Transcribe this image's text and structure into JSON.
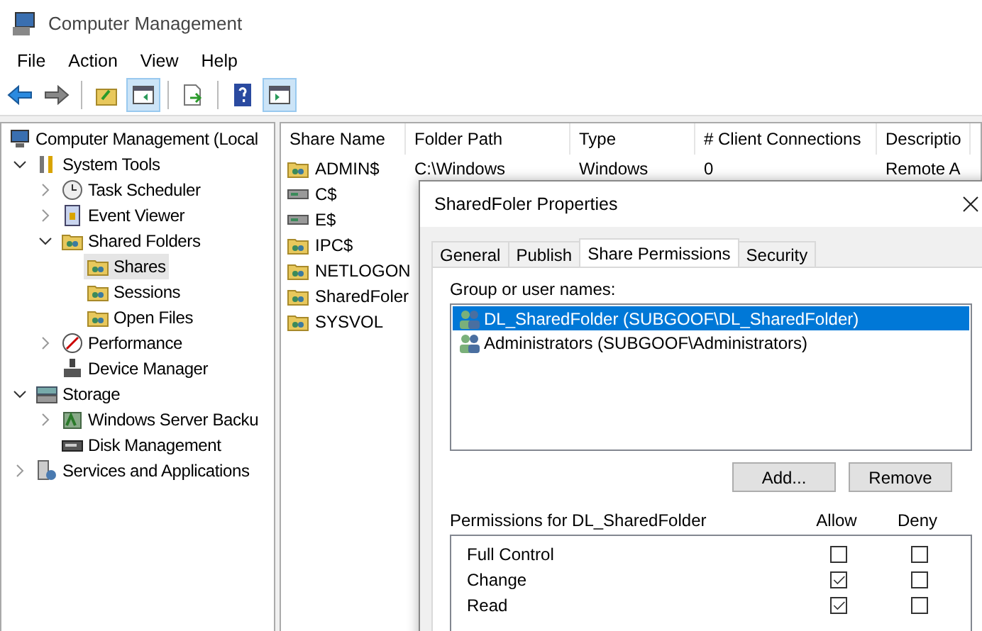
{
  "window": {
    "title": "Computer Management"
  },
  "menu": [
    "File",
    "Action",
    "View",
    "Help"
  ],
  "toolbar": [
    {
      "kind": "back",
      "pressed": false
    },
    {
      "kind": "forward",
      "pressed": false
    },
    {
      "kind": "separator"
    },
    {
      "kind": "up",
      "pressed": false
    },
    {
      "kind": "tree-pane",
      "pressed": true
    },
    {
      "kind": "separator"
    },
    {
      "kind": "export",
      "pressed": false
    },
    {
      "kind": "separator"
    },
    {
      "kind": "help",
      "pressed": false
    },
    {
      "kind": "action-pane",
      "pressed": true
    }
  ],
  "tree": [
    {
      "label": "Computer Management (Local",
      "kind": "computer",
      "selected": false,
      "children": [
        {
          "label": "System Tools",
          "kind": "tools",
          "expanded": true,
          "selected": false,
          "children": [
            {
              "label": "Task Scheduler",
              "kind": "clock",
              "expanded": false,
              "selected": false
            },
            {
              "label": "Event Viewer",
              "kind": "log",
              "expanded": false,
              "selected": false
            },
            {
              "label": "Shared Folders",
              "kind": "share",
              "expanded": true,
              "selected": false,
              "children": [
                {
                  "label": "Shares",
                  "kind": "share",
                  "selected": true
                },
                {
                  "label": "Sessions",
                  "kind": "share",
                  "selected": false
                },
                {
                  "label": "Open Files",
                  "kind": "share",
                  "selected": false
                }
              ]
            },
            {
              "label": "Performance",
              "kind": "gauge",
              "expanded": false,
              "selected": false
            },
            {
              "label": "Device Manager",
              "kind": "device",
              "selected": false
            }
          ]
        },
        {
          "label": "Storage",
          "kind": "storage",
          "expanded": true,
          "selected": false,
          "children": [
            {
              "label": "Windows Server Backu",
              "kind": "backup",
              "expanded": false,
              "selected": false
            },
            {
              "label": "Disk Management",
              "kind": "disk",
              "selected": false
            }
          ]
        },
        {
          "label": "Services and Applications",
          "kind": "services",
          "expanded": false,
          "selected": false
        }
      ]
    }
  ],
  "table": {
    "columns": [
      "Share Name",
      "Folder Path",
      "Type",
      "# Client Connections",
      "Descriptio"
    ],
    "rows": [
      {
        "kind": "share",
        "cells": [
          "ADMIN$",
          "C:\\Windows",
          "Windows",
          "0",
          "Remote A"
        ]
      },
      {
        "kind": "drive",
        "cells": [
          "C$"
        ]
      },
      {
        "kind": "drive",
        "cells": [
          "E$"
        ]
      },
      {
        "kind": "share",
        "cells": [
          "IPC$"
        ]
      },
      {
        "kind": "share",
        "cells": [
          "NETLOGON"
        ]
      },
      {
        "kind": "share",
        "cells": [
          "SharedFoler"
        ]
      },
      {
        "kind": "share",
        "cells": [
          "SYSVOL"
        ]
      }
    ]
  },
  "dialog": {
    "title": "SharedFoler Properties",
    "tabs": [
      {
        "label": "General",
        "selected": false
      },
      {
        "label": "Publish",
        "selected": false
      },
      {
        "label": "Share Permissions",
        "selected": true
      },
      {
        "label": "Security",
        "selected": false
      }
    ],
    "group_label": "Group or user names:",
    "principals": [
      {
        "name": "DL_SharedFolder (SUBGOOF\\DL_SharedFolder)",
        "selected": true
      },
      {
        "name": "Administrators (SUBGOOF\\Administrators)",
        "selected": false
      }
    ],
    "buttons": [
      "Add...",
      "Remove"
    ],
    "permissions_label": "Permissions for DL_SharedFolder",
    "permission_columns": [
      "Allow",
      "Deny"
    ],
    "permissions": [
      {
        "name": "Full Control",
        "allow": false,
        "deny": false
      },
      {
        "name": "Change",
        "allow": true,
        "deny": false
      },
      {
        "name": "Read",
        "allow": true,
        "deny": false
      }
    ]
  }
}
